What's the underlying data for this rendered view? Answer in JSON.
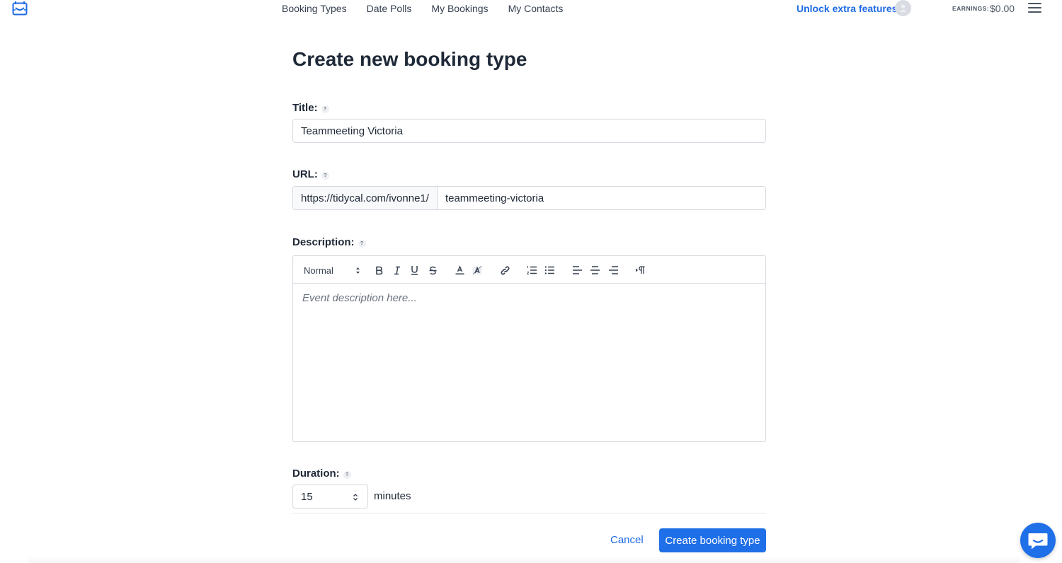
{
  "nav": {
    "items": [
      "Booking Types",
      "Date Polls",
      "My Bookings",
      "My Contacts"
    ],
    "unlock_label": "Unlock extra features!",
    "earnings_label": "EARNINGS:",
    "earnings_value": "$0.00"
  },
  "page": {
    "title": "Create new booking type"
  },
  "form": {
    "title_label": "Title:",
    "title_value": "Teammeeting Victoria",
    "url_label": "URL:",
    "url_prefix": "https://tidycal.com/ivonne1/",
    "url_slug": "teammeeting-victoria",
    "description_label": "Description:",
    "description_placeholder": "Event description here...",
    "format_select": "Normal",
    "duration_label": "Duration:",
    "duration_value": "15",
    "duration_unit": "minutes",
    "help_glyph": "?"
  },
  "actions": {
    "cancel_label": "Cancel",
    "create_label": "Create booking type"
  },
  "colors": {
    "accent": "#1f6fe8",
    "link": "#1d6ae5"
  }
}
